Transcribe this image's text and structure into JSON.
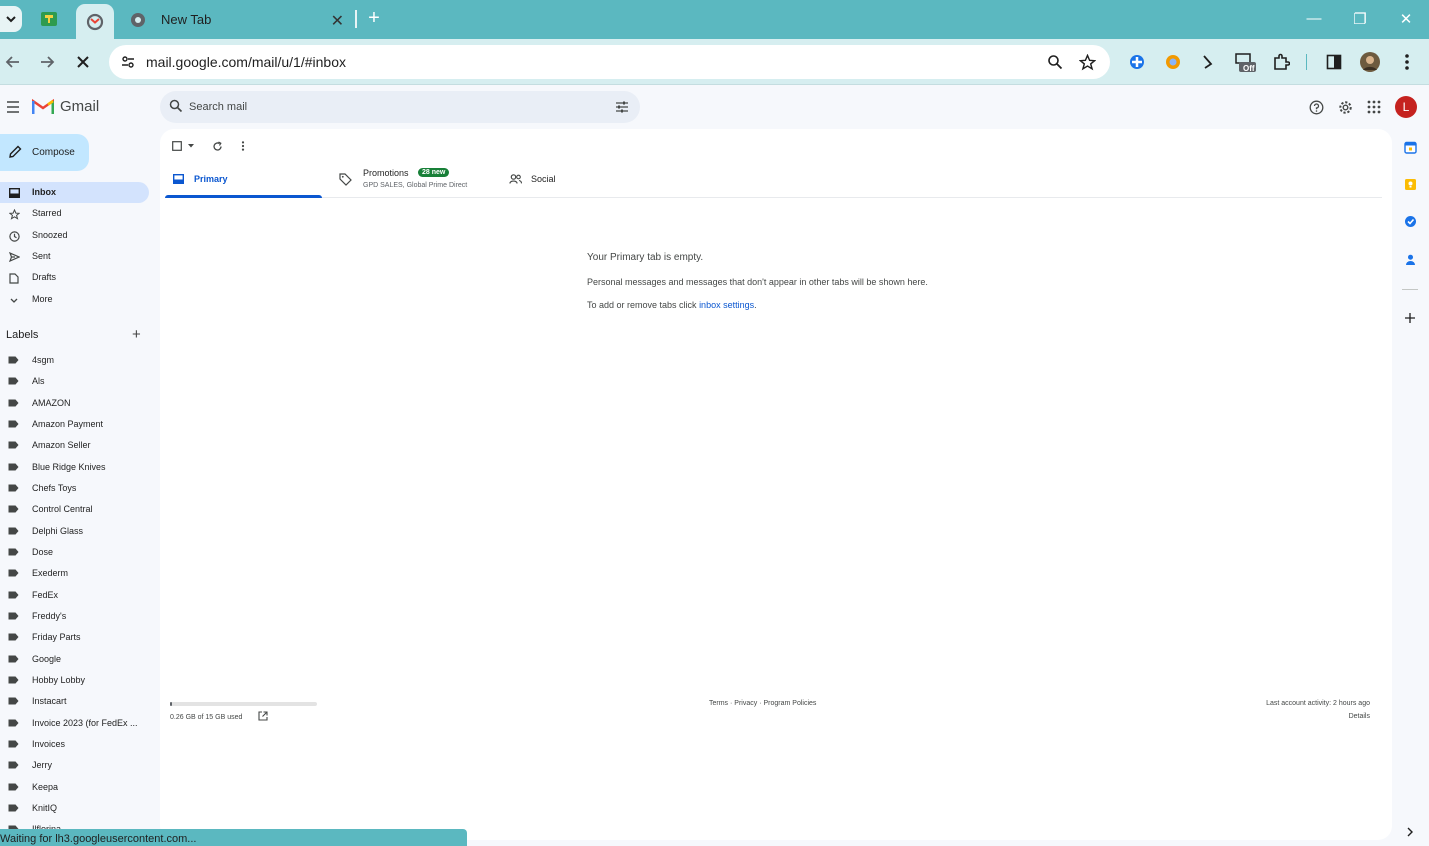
{
  "browser": {
    "tabs": [
      {
        "title": "",
        "active": false
      },
      {
        "title": "",
        "active": true
      },
      {
        "title": "New Tab",
        "active": false
      }
    ],
    "url": "mail.google.com/mail/u/1/#inbox",
    "status": "Waiting for lh3.googleusercontent.com...",
    "ext_badge": "Off"
  },
  "gmail": {
    "brand": "Gmail",
    "search_placeholder": "Search mail",
    "avatar_initial": "L",
    "compose_label": "Compose",
    "nav": [
      {
        "label": "Inbox",
        "icon": "inbox-icon",
        "active": true
      },
      {
        "label": "Starred",
        "icon": "star-icon"
      },
      {
        "label": "Snoozed",
        "icon": "clock-icon"
      },
      {
        "label": "Sent",
        "icon": "send-icon"
      },
      {
        "label": "Drafts",
        "icon": "draft-icon"
      },
      {
        "label": "More",
        "icon": "chevron-down-icon"
      }
    ],
    "labels_heading": "Labels",
    "labels": [
      "4sgm",
      "Als",
      "AMAZON",
      "Amazon Payment",
      "Amazon Seller",
      "Blue Ridge Knives",
      "Chefs Toys",
      "Control Central",
      "Delphi Glass",
      "Dose",
      "Exederm",
      "FedEx",
      "Freddy's",
      "Friday Parts",
      "Google",
      "Hobby Lobby",
      "Instacart",
      "Invoice 2023 (for FedEx ...",
      "Invoices",
      "Jerry",
      "Keepa",
      "KnitIQ",
      "Ilflorina"
    ],
    "tabs": {
      "primary": "Primary",
      "promotions": "Promotions",
      "promotions_badge": "28 new",
      "promotions_sub": "GPD SALES, Global Prime Direct",
      "social": "Social"
    },
    "empty": {
      "title": "Your Primary tab is empty.",
      "line1": "Personal messages and messages that don't appear in other tabs will be shown here.",
      "line2_prefix": "To add or remove tabs click ",
      "line2_link": "inbox settings",
      "line2_suffix": "."
    },
    "footer": {
      "storage": "0.26 GB of 15 GB used",
      "storage_fraction": 0.017,
      "terms": "Terms",
      "privacy": "Privacy",
      "policies": "Program Policies",
      "sep": " · ",
      "activity": "Last account activity: 2 hours ago",
      "details": "Details"
    }
  },
  "colors": {
    "chrome_teal": "#5bb8c0",
    "toolbar_bg": "#d6eef0",
    "compose_bg": "#c2e7ff",
    "active_nav": "#d3e3fd",
    "accent_blue": "#0b57d0",
    "badge_green": "#188038",
    "avatar_red": "#c5221f"
  }
}
